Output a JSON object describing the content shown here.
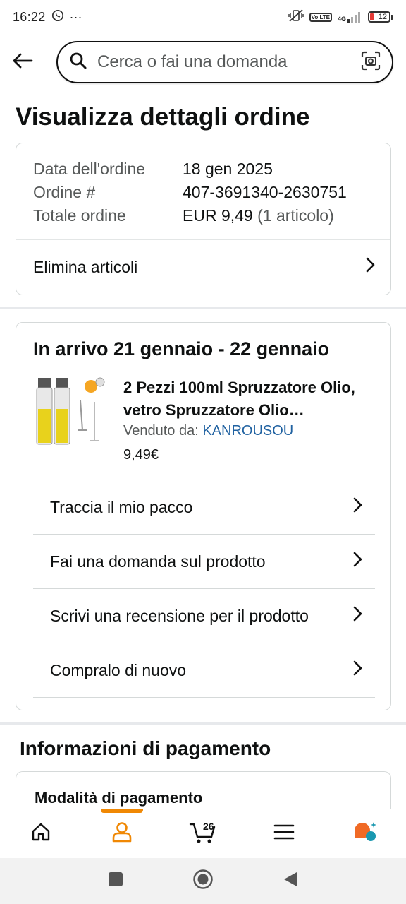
{
  "status_bar": {
    "time": "16:22",
    "dots": "···",
    "volte": "Vo LTE",
    "network": "4G",
    "battery": "12"
  },
  "search": {
    "placeholder": "Cerca o fai una domanda"
  },
  "page": {
    "title": "Visualizza dettagli ordine"
  },
  "order_summary": {
    "rows": [
      {
        "label": "Data dell'ordine",
        "value": "18 gen 2025"
      },
      {
        "label": "Ordine #",
        "value": "407-3691340-2630751"
      },
      {
        "label": "Totale ordine",
        "value": "EUR 9,49",
        "extra": "(1 articolo)"
      }
    ],
    "delete_items_label": "Elimina articoli"
  },
  "shipment": {
    "arrival_title": "In arrivo 21 gennaio - 22 gennaio",
    "product": {
      "name": "2 Pezzi 100ml Spruzzatore Olio, vetro Spruzzatore Olio…",
      "seller_prefix": "Venduto da: ",
      "seller_name": "KANROUSOU",
      "price": "9,49€"
    },
    "actions": [
      "Traccia il mio pacco",
      "Fai una domanda sul prodotto",
      "Scrivi una recensione per il prodotto",
      "Compralo di nuovo"
    ]
  },
  "payment": {
    "section_title": "Informazioni di pagamento",
    "method_label": "Modalità di pagamento"
  },
  "bottom_nav": {
    "cart_count": "26",
    "accent_color": "#f08804"
  }
}
